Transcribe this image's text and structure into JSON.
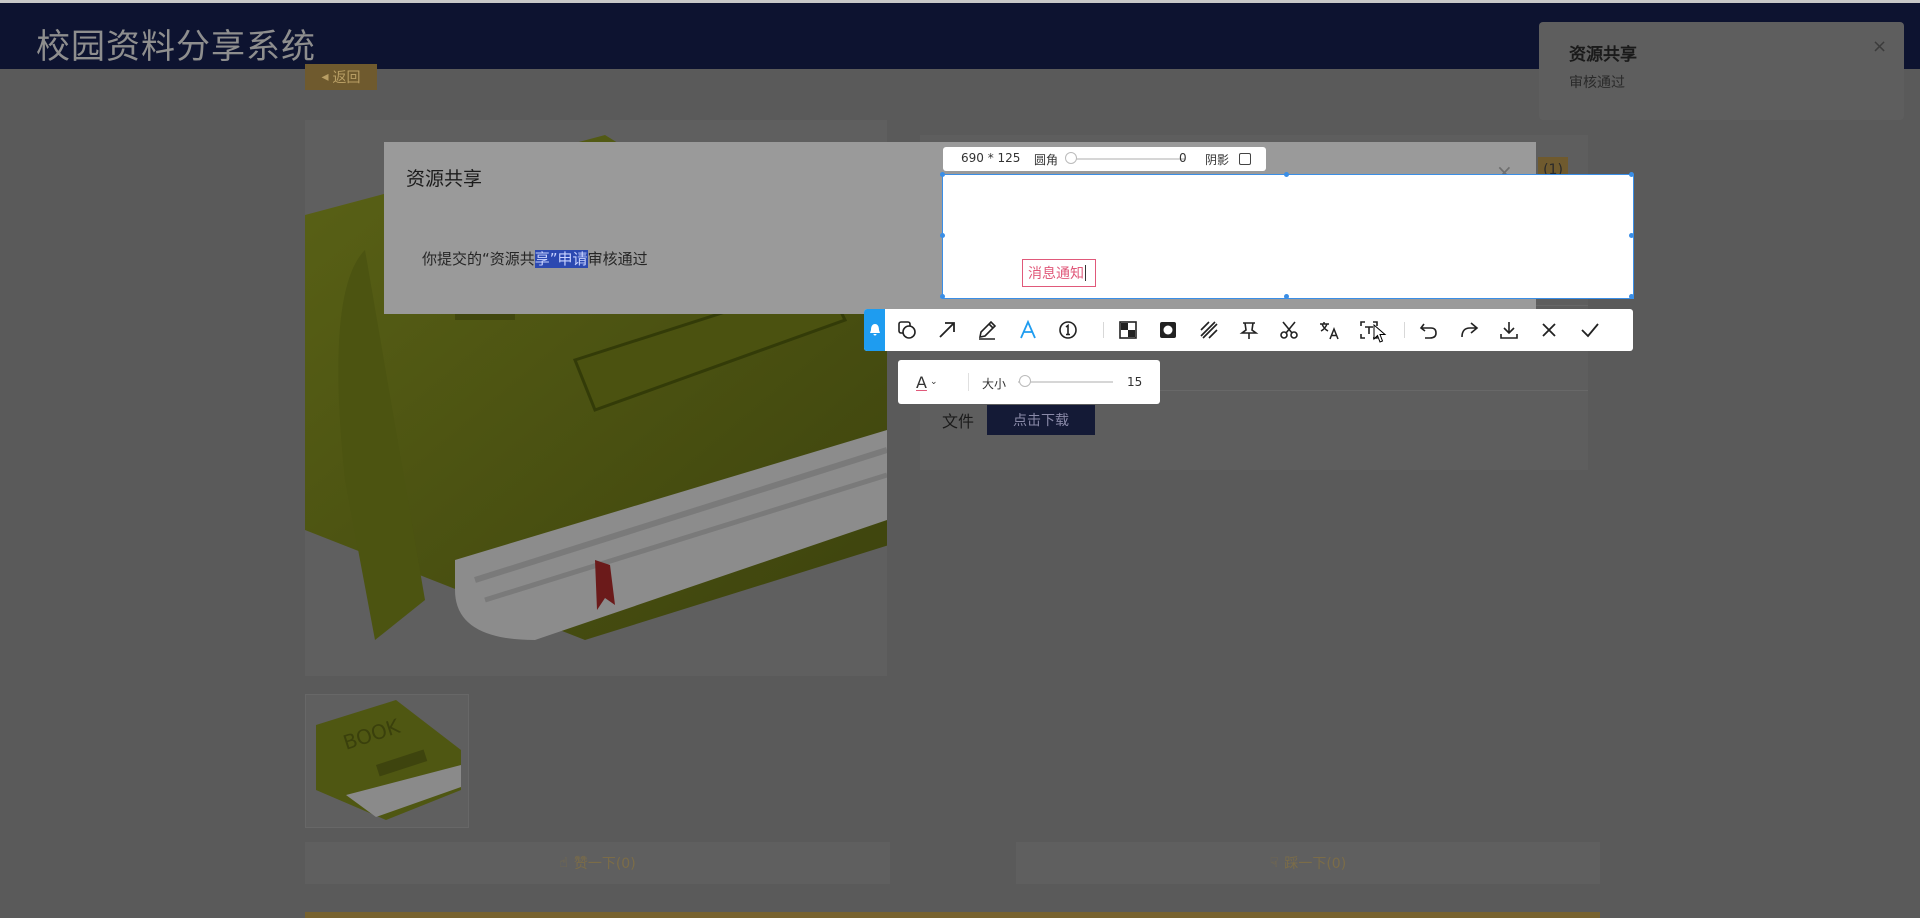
{
  "header": {
    "title": "校园资料分享系统"
  },
  "page": {
    "back_label": "返回",
    "rate_badge": "(1)",
    "file_label": "文件",
    "download_label": "点击下载",
    "like_label": "赞一下(0)",
    "dislike_label": "踩一下(0)"
  },
  "toast": {
    "title": "资源共享",
    "text": "审核通过",
    "close": "×"
  },
  "dialog": {
    "title": "资源共享",
    "close": "×",
    "message_parts": [
      "你提交的“资源共",
      "享”申请",
      "审核通过"
    ]
  },
  "capture": {
    "size_label": "690 * 125",
    "radius_label": "圆角",
    "radius_value": "0",
    "shadow_label": "阴影",
    "shadow_checked": false,
    "text_box_value": "消息通知"
  },
  "toolbar": {
    "tools": [
      "shape-icon",
      "arrow-icon",
      "pen-icon",
      "text-icon",
      "number-icon",
      "mosaic-icon",
      "blur-icon",
      "hatch-icon",
      "pin-icon",
      "cut-icon",
      "translate-icon",
      "ocr-icon",
      "undo-icon",
      "redo-icon",
      "download-icon",
      "close-icon",
      "confirm-icon"
    ],
    "active_tool": "text-icon",
    "accent_color": "#1e9cf0"
  },
  "text_options": {
    "color_glyph": "A",
    "color": "#e0597a",
    "size_label": "大小",
    "size_value": "15"
  },
  "colors": {
    "header_bg": "#0d1330",
    "selection_border": "#3a8ee6",
    "highlight": "#2c49b1"
  }
}
